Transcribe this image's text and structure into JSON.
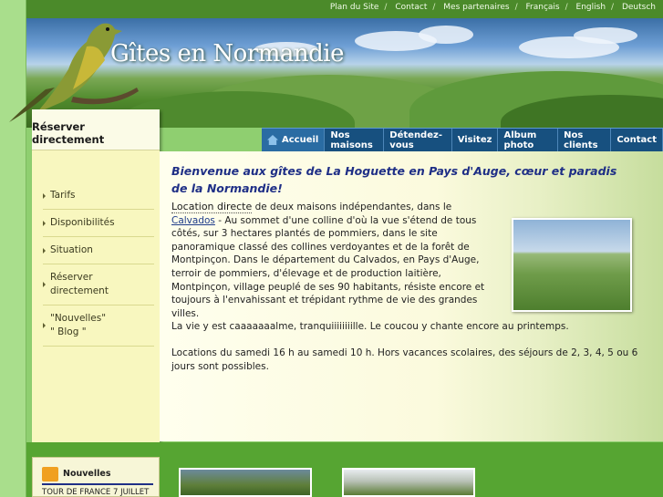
{
  "topnav": {
    "items": [
      "Plan du Site",
      "Contact",
      "Mes partenaires",
      "Français",
      "English",
      "Deutsch"
    ],
    "separator": "/"
  },
  "site_title": "Gîtes en Normandie",
  "mainnav": {
    "items": [
      "Accueil",
      "Nos maisons",
      "Détendez-vous",
      "Visitez",
      "Album photo",
      "Nos clients",
      "Contact"
    ],
    "active": "Accueil"
  },
  "sidebar": {
    "header": "Réserver directement",
    "items": [
      "Tarifs",
      "Disponibilités",
      "Situation",
      "Réserver directement",
      "\"Nouvelles\" \" Blog \""
    ]
  },
  "content": {
    "welcome": "Bienvenue aux gîtes de La Hoguette en Pays d'Auge, cœur et paradis de la Normandie!",
    "lead": "Location directe",
    "p1_a": " de deux maisons indépendantes, dans le ",
    "p1_link": "Calvados",
    "p1_b": " - Au sommet d'une colline d'où la vue s'étend de tous côtés, sur 3 hectares plantés de pommiers, dans le site panoramique classé des collines verdoyantes et de la forêt de Montpinçon. Dans le département du Calvados, en Pays d'Auge, terroir de pommiers, d'élevage et de production laitière, Montpinçon, village peuplé de ses 90 habitants, résiste encore et toujours à l'envahissant et trépidant rythme de vie des grandes villes.",
    "p2": "La vie y est caaaaaaalme, tranquiiiiiiiille. Le coucou y chante encore au printemps.",
    "p3": "Locations du samedi 16 h au samedi 10 h. Hors vacances scolaires, des séjours de 2, 3, 4, 5 ou 6 jours sont possibles."
  },
  "news": {
    "title": "Nouvelles",
    "item": "TOUR DE FRANCE 7 JUILLET"
  },
  "colors": {
    "nav_blue": "#17507f",
    "title_blue": "#1f2f86",
    "green": "#56a532",
    "sidebar_yellow": "#f8f7bf"
  }
}
